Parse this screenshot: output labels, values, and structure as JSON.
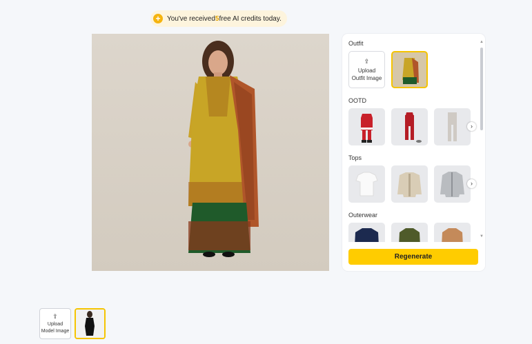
{
  "notice": {
    "prefix": "You've received ",
    "count": "5",
    "suffix": " free AI credits today.",
    "icon": "plus-circle-icon"
  },
  "panel": {
    "sections": [
      {
        "title": "Outfit",
        "upload_label_1": "Upload",
        "upload_label_2": "Outfit Image"
      },
      {
        "title": "OOTD"
      },
      {
        "title": "Tops"
      },
      {
        "title": "Outerwear"
      }
    ],
    "regenerate_label": "Regenerate"
  },
  "model": {
    "upload_label_1": "Upload",
    "upload_label_2": "Model Image"
  },
  "colors": {
    "accent": "#ffcc00",
    "selected_border": "#f5c400"
  }
}
